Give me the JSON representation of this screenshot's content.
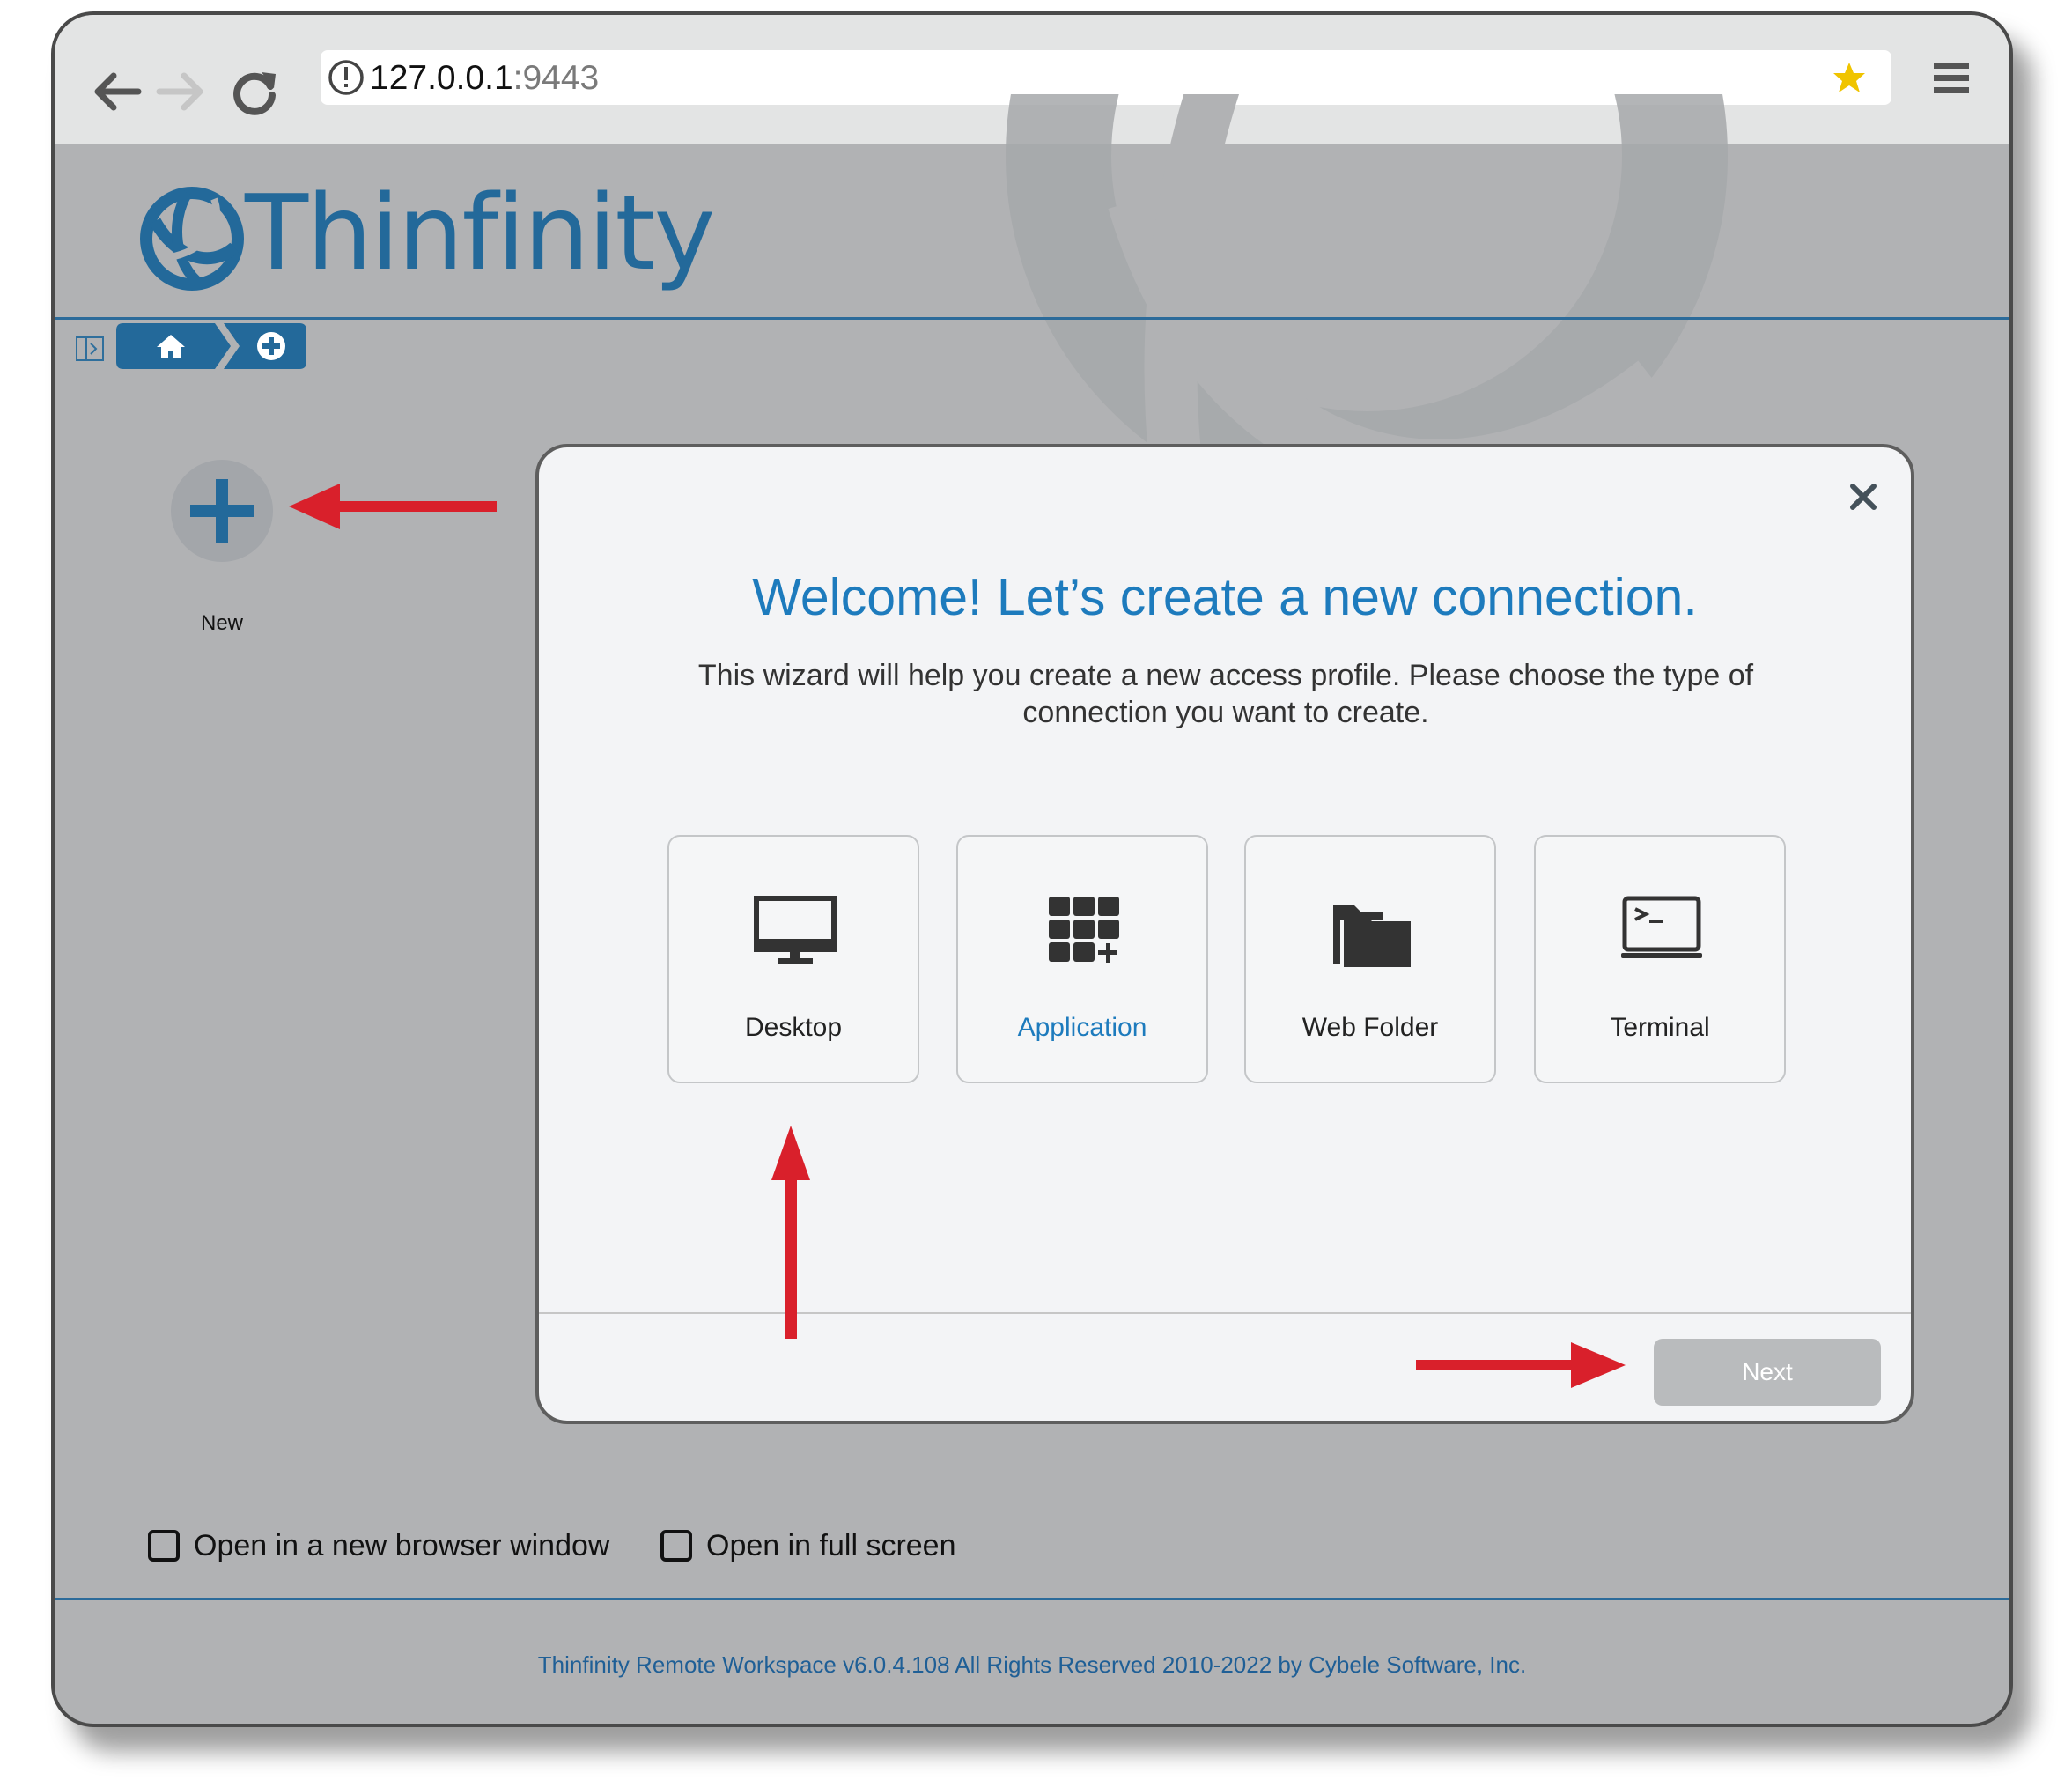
{
  "browser": {
    "url_host": "127.0.0.1",
    "url_port": ":9443",
    "bookmark_star_color": "#f0c400"
  },
  "brand": {
    "name": "Thinfinity",
    "color": "#23699a"
  },
  "breadcrumb": {
    "home_icon": "home-icon",
    "add_icon": "plus-circle-icon"
  },
  "sidebar": {
    "new_label": "New"
  },
  "modal": {
    "title": "Welcome! Let’s create a new connection.",
    "subtitle": "This wizard will help you create a new access profile. Please choose the type of connection you want to create.",
    "options": [
      {
        "label": "Desktop",
        "icon": "monitor-icon"
      },
      {
        "label": "Application",
        "icon": "app-grid-icon",
        "selected": true
      },
      {
        "label": "Web Folder",
        "icon": "folder-icon"
      },
      {
        "label": "Terminal",
        "icon": "terminal-icon"
      }
    ],
    "next_label": "Next"
  },
  "options": {
    "new_window_label": "Open in a new browser window",
    "full_screen_label": "Open in full screen"
  },
  "footer": {
    "text": "Thinfinity Remote Workspace v6.0.4.108 All Rights Reserved 2010-2022 by Cybele Software, Inc."
  },
  "colors": {
    "accent": "#1d7bbd",
    "annotation_arrow": "#d9202b",
    "background": "#b1b2b4"
  }
}
